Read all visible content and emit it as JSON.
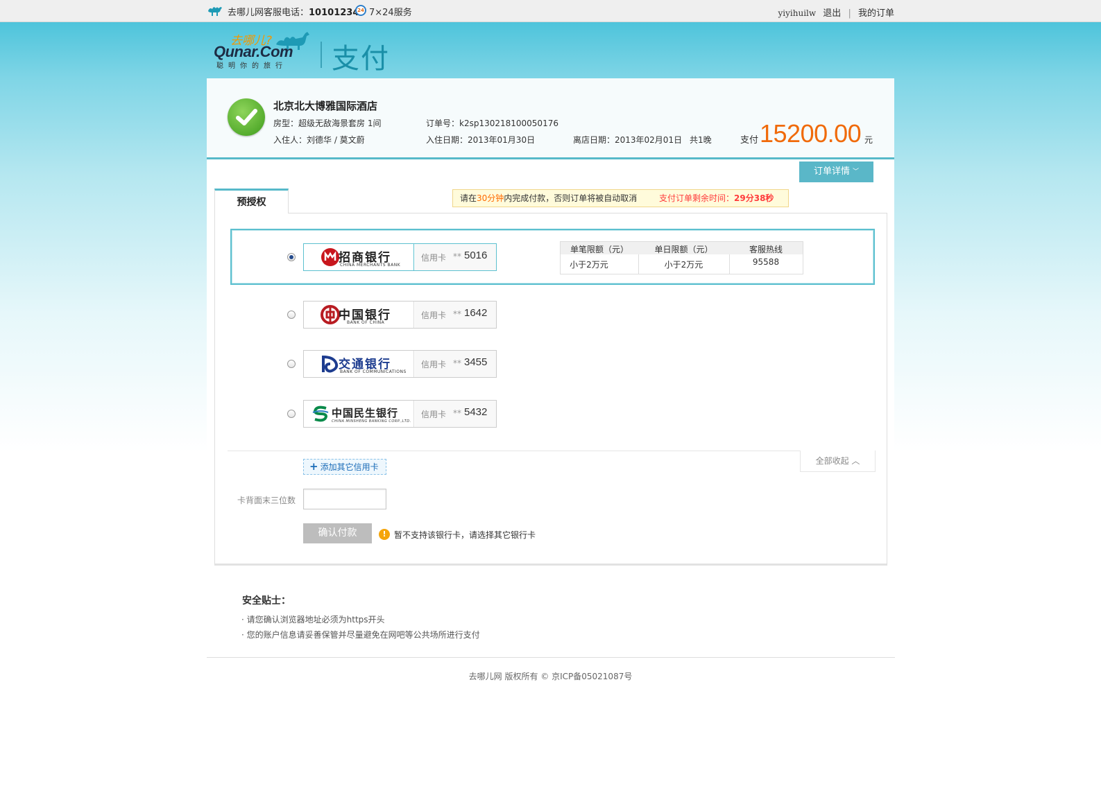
{
  "topbar": {
    "hotline_label": "去哪儿网客服电话：",
    "hotline_number": "10101234",
    "service_icon_text": "24",
    "service_text": "7×24服务",
    "username": "yiyihuilw",
    "logout": "退出",
    "divider": "|",
    "my_orders": "我的订单"
  },
  "logo": {
    "cn": "去哪儿?",
    "brand": "Qunar.Com",
    "slogan": "聪明你的旅行",
    "product": "支付"
  },
  "order": {
    "hotel_name": "北京北大博雅国际酒店",
    "room_type": "房型：超级无敌海景套房  1间",
    "guests": "入住人：刘德华 / 莫文蔚",
    "order_no": "订单号：k2sp130218100050176",
    "checkin": "入住日期：2013年01月30日",
    "checkout": "离店日期：2013年02月01日",
    "nights": "共1晚",
    "pay_label": "支付",
    "amount": "15200.00",
    "unit": "元",
    "detail_button": "订单详情",
    "detail_chevron": "﹀"
  },
  "tab": {
    "label": "预授权"
  },
  "warning": {
    "prefix": "请在",
    "highlight": "30分钟",
    "suffix": "内完成付款，否则订单将被自动取消",
    "countdown_label": "支付订单剩余时间：",
    "countdown_value": "29分38秒"
  },
  "banks": [
    {
      "name_cn": "招商银行",
      "name_en": "CHINA MERCHANTS BANK",
      "type": "信用卡",
      "mask": "**",
      "last4": "5016",
      "selected": true,
      "brand_color": "#c8161d"
    },
    {
      "name_cn": "中国银行",
      "name_en": "BANK OF CHINA",
      "type": "信用卡",
      "mask": "**",
      "last4": "1642",
      "selected": false,
      "brand_color": "#b81c22"
    },
    {
      "name_cn": "交通银行",
      "name_en": "BANK OF COMMUNICATIONS",
      "type": "信用卡",
      "mask": "**",
      "last4": "3455",
      "selected": false,
      "brand_color": "#1d3c8f"
    },
    {
      "name_cn": "中国民生银行",
      "name_en": "CHINA MINSHENG BANKING CORP.,LTD.",
      "type": "信用卡",
      "mask": "**",
      "last4": "5432",
      "selected": false,
      "brand_color": "#0a8a4a"
    }
  ],
  "limits": {
    "headers": [
      "单笔限额（元）",
      "单日限额（元）",
      "客服热线"
    ],
    "values": [
      "小于2万元",
      "小于2万元",
      "95588"
    ]
  },
  "actions": {
    "add_card": "添加其它信用卡",
    "add_icon": "+",
    "collapse": "全部收起",
    "collapse_icon": "︿",
    "cvv_label": "卡背面末三位数",
    "cvv_value": "",
    "confirm": "确认付款",
    "info_icon": "!",
    "message": "暂不支持该银行卡，请选择其它银行卡"
  },
  "tips": {
    "title": "安全贴士：",
    "items": [
      "· 请您确认浏览器地址必须为https开头",
      "· 您的账户信息请妥善保管并尽量避免在网吧等公共场所进行支付"
    ]
  },
  "footer": {
    "text": "去哪儿网 版权所有 © 京ICP备05021087号"
  }
}
